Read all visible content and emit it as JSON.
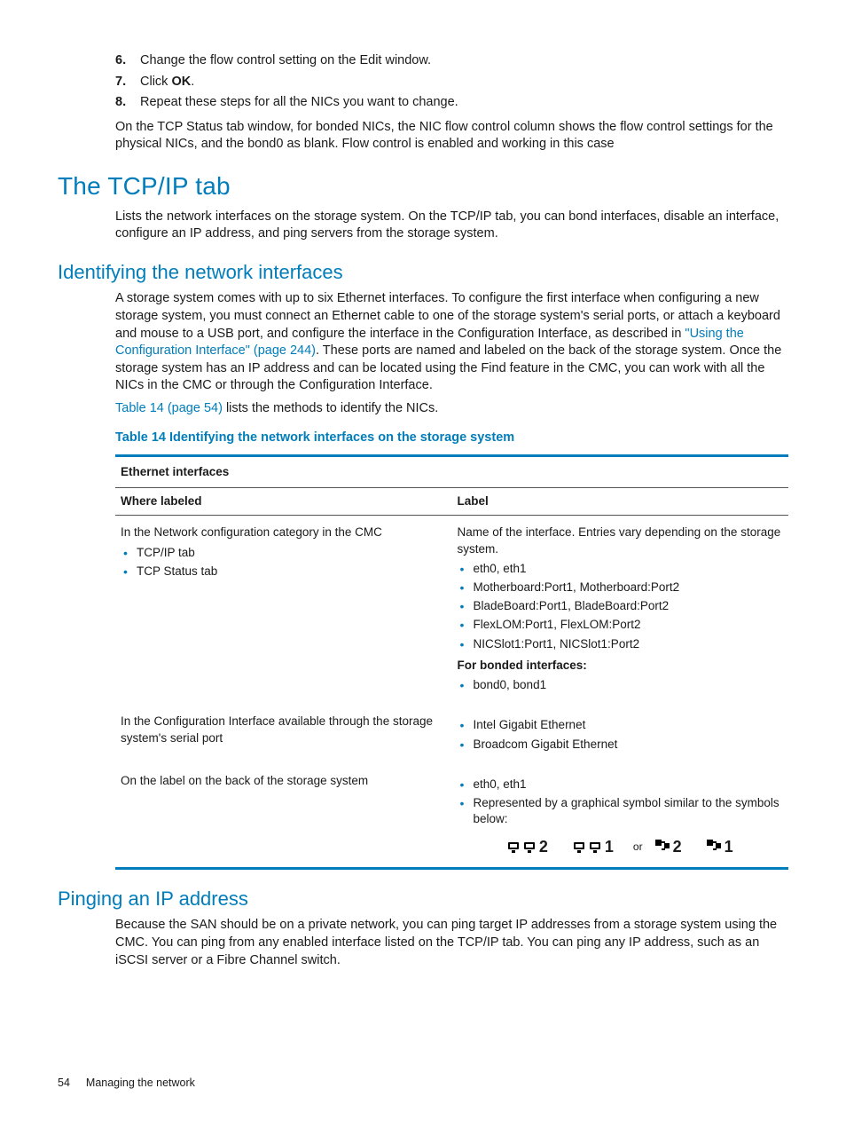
{
  "steps": {
    "s6_num": "6.",
    "s6_text_a": "Change the flow control setting on the Edit window.",
    "s7_num": "7.",
    "s7_text_a": "Click ",
    "s7_text_b": "OK",
    "s7_text_c": ".",
    "s8_num": "8.",
    "s8_text_a": "Repeat these steps for all the NICs you want to change."
  },
  "para_tcp_status": "On the TCP Status tab window, for bonded NICs, the NIC flow control column shows the flow control settings for the physical NICs, and the bond0 as blank. Flow control is enabled and working in this case",
  "h1_tcpip": "The TCP/IP tab",
  "para_tcpip": "Lists the network interfaces on the storage system. On the TCP/IP tab, you can bond interfaces, disable an interface, configure an IP address, and ping servers from the storage system.",
  "h2_identifying": "Identifying the network interfaces",
  "para_ident_a": "A storage system comes with up to six Ethernet interfaces. To configure the first interface when configuring a new storage system, you must connect an Ethernet cable to one of the storage system's serial ports, or attach a keyboard and mouse to a USB port, and configure the interface in the Configuration Interface, as described in ",
  "para_ident_link": "\"Using the Configuration Interface\" (page 244)",
  "para_ident_b": ". These ports are named and labeled on the back of the storage system. Once the storage system has an IP address and can be located using the Find feature in the CMC, you can work with all the NICs in the CMC or through the Configuration Interface.",
  "para_table_ref_link": "Table 14 (page 54)",
  "para_table_ref_text": " lists the methods to identify the NICs.",
  "table_title": "Table 14 Identifying the network interfaces on the storage system",
  "table": {
    "group_header": "Ethernet interfaces",
    "col1": "Where labeled",
    "col2": "Label",
    "row1": {
      "left_intro": "In the Network configuration category in the CMC",
      "left_bullets": [
        "TCP/IP tab",
        "TCP Status tab"
      ],
      "right_intro": "Name of the interface. Entries vary depending on the storage system.",
      "right_bullets": [
        "eth0, eth1",
        "Motherboard:Port1, Motherboard:Port2",
        "BladeBoard:Port1, BladeBoard:Port2",
        "FlexLOM:Port1, FlexLOM:Port2",
        "NICSlot1:Port1, NICSlot1:Port2"
      ],
      "bonded_label": "For bonded interfaces:",
      "bonded_bullets": [
        "bond0, bond1"
      ]
    },
    "row2": {
      "left": "In the Configuration Interface available through the storage system's serial port",
      "right_bullets": [
        "Intel Gigabit Ethernet",
        "Broadcom Gigabit Ethernet"
      ]
    },
    "row3": {
      "left": "On the label on the back of the storage system",
      "right_bullets": [
        "eth0, eth1",
        "Represented by a graphical symbol similar to the symbols below:"
      ],
      "sym2": "2",
      "sym1": "1",
      "or": "or"
    }
  },
  "h2_pinging": "Pinging an IP address",
  "para_pinging": "Because the SAN should be on a private network, you can ping target IP addresses from a storage system using the CMC. You can ping from any enabled interface listed on the TCP/IP tab. You can ping any IP address, such as an iSCSI server or a Fibre Channel switch.",
  "footer_page": "54",
  "footer_text": "Managing the network"
}
